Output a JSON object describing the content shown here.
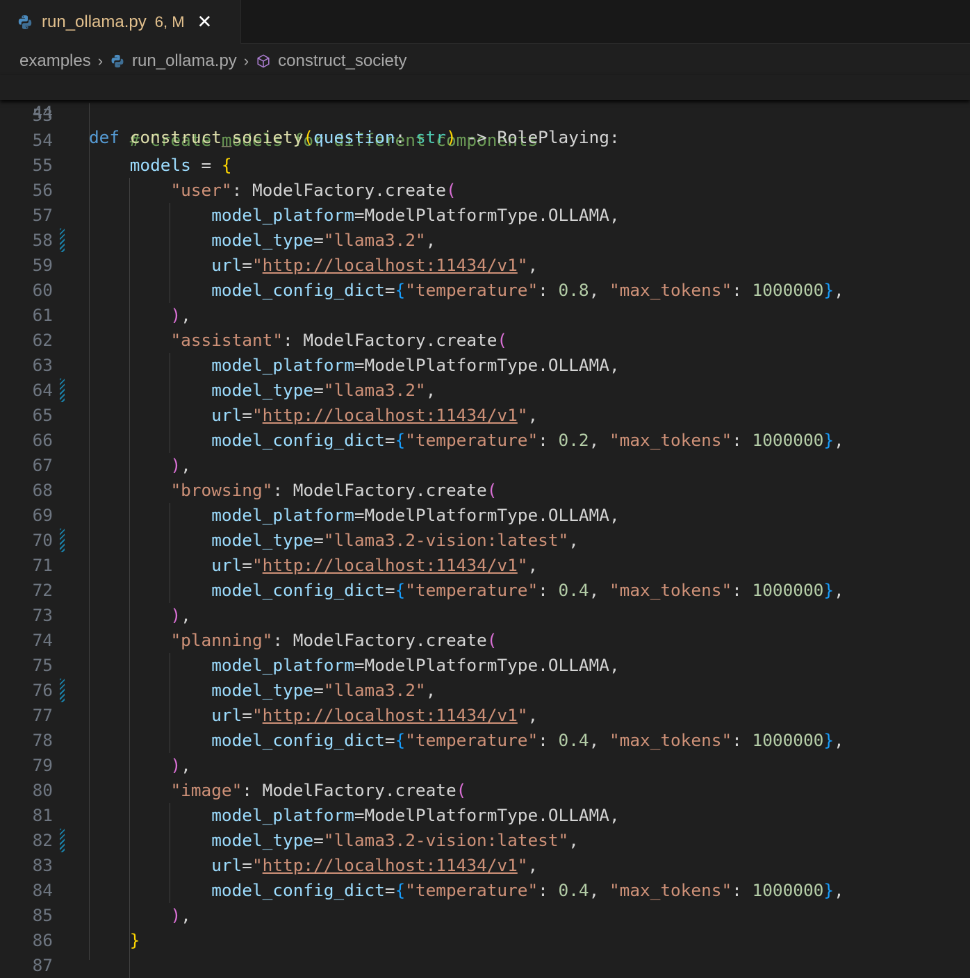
{
  "tab": {
    "filename": "run_ollama.py",
    "status": "6, M",
    "close_glyph": "✕",
    "icon": "python-icon"
  },
  "breadcrumb": {
    "items": [
      "examples",
      "run_ollama.py",
      "construct_society"
    ],
    "separator": "›"
  },
  "sticky": {
    "line_number": "44",
    "def": "def",
    "function": "construct_society",
    "param": "question",
    "type": "str",
    "arrow": "->",
    "return_type": "RolePlaying"
  },
  "comment": "# Create models for different components",
  "models_var": "models",
  "model_entries": [
    {
      "key": "\"user\"",
      "type": "\"llama3.2\"",
      "temperature": "0.8"
    },
    {
      "key": "\"assistant\"",
      "type": "\"llama3.2\"",
      "temperature": "0.2"
    },
    {
      "key": "\"browsing\"",
      "type": "\"llama3.2-vision:latest\"",
      "temperature": "0.4"
    },
    {
      "key": "\"planning\"",
      "type": "\"llama3.2\"",
      "temperature": "0.4"
    },
    {
      "key": "\"image\"",
      "type": "\"llama3.2-vision:latest\"",
      "temperature": "0.4"
    }
  ],
  "common": {
    "factory_call": "ModelFactory.create",
    "platform_arg": "model_platform",
    "platform_value": "ModelPlatformType.OLLAMA",
    "type_arg": "model_type",
    "url_arg": "url",
    "url_value": "http://localhost:11434/v1",
    "config_arg": "model_config_dict",
    "temperature_key": "\"temperature\"",
    "max_tokens_key": "\"max_tokens\"",
    "max_tokens_value": "1000000"
  },
  "line_numbers": [
    "53",
    "54",
    "55",
    "56",
    "57",
    "58",
    "59",
    "60",
    "61",
    "62",
    "63",
    "64",
    "65",
    "66",
    "67",
    "68",
    "69",
    "70",
    "71",
    "72",
    "73",
    "74",
    "75",
    "76",
    "77",
    "78",
    "79",
    "80",
    "81",
    "82",
    "83",
    "84",
    "85",
    "86",
    "87"
  ],
  "modified_lines": [
    "58",
    "64",
    "70",
    "76",
    "82"
  ],
  "colors": {
    "background": "#1f1f1f",
    "keyword": "#569cd6",
    "function": "#dcdcaa",
    "parameter": "#9cdcfe",
    "string": "#ce9178",
    "number": "#b5cea8",
    "comment": "#6a9955",
    "modified_gutter": "#1b81a8"
  }
}
